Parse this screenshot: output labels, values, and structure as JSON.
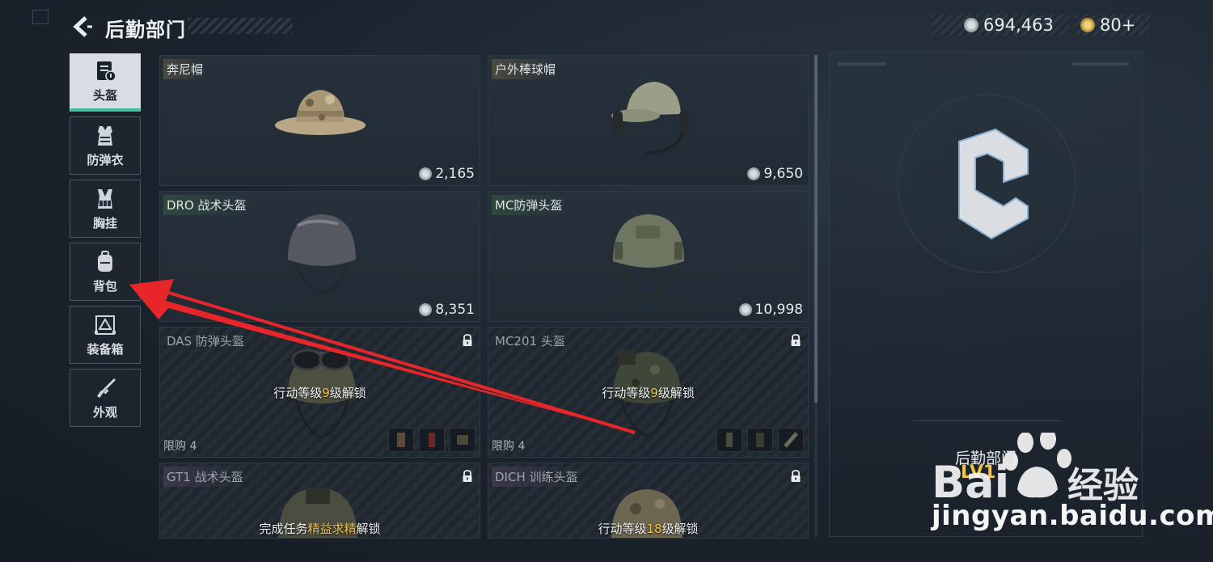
{
  "header": {
    "title": "后勤部门",
    "currency_main": "694,463",
    "currency_secondary": "80+",
    "back_icon": "chevron-left-icon"
  },
  "colors": {
    "accent_green": "#3fbf9a",
    "highlight_yellow": "#f3c04b",
    "arrow_red": "#e8262a"
  },
  "sidebar": {
    "items": [
      {
        "label": "头盔",
        "icon": "helmet-icon",
        "active": true
      },
      {
        "label": "防弹衣",
        "icon": "vest-icon",
        "active": false
      },
      {
        "label": "胸挂",
        "icon": "chest-rig-icon",
        "active": false
      },
      {
        "label": "背包",
        "icon": "backpack-icon",
        "active": false
      },
      {
        "label": "装备箱",
        "icon": "equipment-box-icon",
        "active": false
      },
      {
        "label": "外观",
        "icon": "rifle-icon",
        "active": false
      }
    ]
  },
  "cards": [
    {
      "name": "奔尼帽",
      "price": "2,165",
      "locked": false
    },
    {
      "name": "户外棒球帽",
      "price": "9,650",
      "locked": false
    },
    {
      "name": "DRO 战术头盔",
      "price": "8,351",
      "locked": false
    },
    {
      "name": "MC防弹头盔",
      "price": "10,998",
      "locked": false
    },
    {
      "name": "DAS 防弹头盔",
      "locked": true,
      "unlock_pre": "行动等级",
      "unlock_hl": "9",
      "unlock_post": "级解锁",
      "limit": "限购 4"
    },
    {
      "name": "MC201 头盔",
      "locked": true,
      "unlock_pre": "行动等级",
      "unlock_hl": "9",
      "unlock_post": "级解锁",
      "limit": "限购 4"
    },
    {
      "name": "GT1 战术头盔",
      "locked": true,
      "unlock_pre": "完成任务",
      "unlock_hl": "精益求精",
      "unlock_post": "解锁"
    },
    {
      "name": "DICH 训练头盔",
      "locked": true,
      "unlock_pre": "行动等级",
      "unlock_hl": "18",
      "unlock_post": "级解锁"
    }
  ],
  "panel": {
    "title": "后勤部门",
    "level": "LV1"
  },
  "watermark": {
    "text": "jingyan.baidu.com",
    "brand": "Bai du 经验"
  }
}
